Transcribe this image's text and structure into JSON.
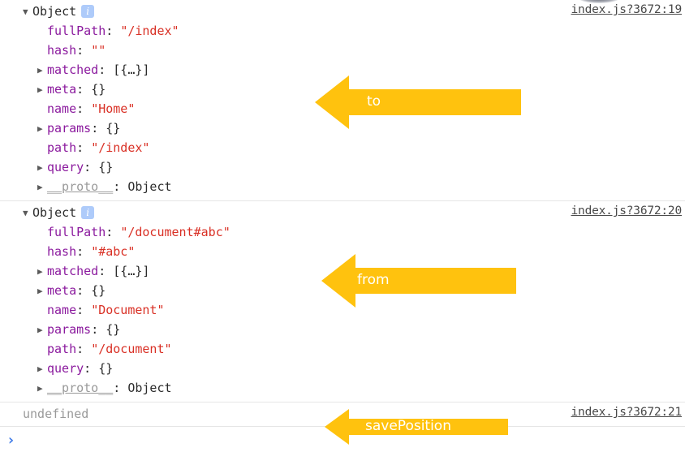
{
  "console": {
    "entries": [
      {
        "id": "entry-to",
        "source_link": "index.js?3672:19",
        "header": "Object",
        "info_icon": "i",
        "properties": [
          {
            "expandable": false,
            "key": "fullPath",
            "value": "\"/index\"",
            "value_type": "string"
          },
          {
            "expandable": false,
            "key": "hash",
            "value": "\"\"",
            "value_type": "string"
          },
          {
            "expandable": true,
            "key": "matched",
            "value": "[{…}]",
            "value_type": "object"
          },
          {
            "expandable": true,
            "key": "meta",
            "value": "{}",
            "value_type": "object"
          },
          {
            "expandable": false,
            "key": "name",
            "value": "\"Home\"",
            "value_type": "string"
          },
          {
            "expandable": true,
            "key": "params",
            "value": "{}",
            "value_type": "object"
          },
          {
            "expandable": false,
            "key": "path",
            "value": "\"/index\"",
            "value_type": "string"
          },
          {
            "expandable": true,
            "key": "query",
            "value": "{}",
            "value_type": "object"
          },
          {
            "expandable": true,
            "key": "__proto__",
            "value": "Object",
            "value_type": "proto"
          }
        ]
      },
      {
        "id": "entry-from",
        "source_link": "index.js?3672:20",
        "header": "Object",
        "info_icon": "i",
        "properties": [
          {
            "expandable": false,
            "key": "fullPath",
            "value": "\"/document#abc\"",
            "value_type": "string"
          },
          {
            "expandable": false,
            "key": "hash",
            "value": "\"#abc\"",
            "value_type": "string"
          },
          {
            "expandable": true,
            "key": "matched",
            "value": "[{…}]",
            "value_type": "object"
          },
          {
            "expandable": true,
            "key": "meta",
            "value": "{}",
            "value_type": "object"
          },
          {
            "expandable": false,
            "key": "name",
            "value": "\"Document\"",
            "value_type": "string"
          },
          {
            "expandable": true,
            "key": "params",
            "value": "{}",
            "value_type": "object"
          },
          {
            "expandable": false,
            "key": "path",
            "value": "\"/document\"",
            "value_type": "string"
          },
          {
            "expandable": true,
            "key": "query",
            "value": "{}",
            "value_type": "object"
          },
          {
            "expandable": true,
            "key": "__proto__",
            "value": "Object",
            "value_type": "proto"
          }
        ]
      },
      {
        "id": "entry-savePosition",
        "source_link": "index.js?3672:21",
        "value": "undefined"
      }
    ],
    "prompt_symbol": "›"
  },
  "annotations": [
    {
      "id": "annotation-to",
      "label": "to"
    },
    {
      "id": "annotation-from",
      "label": "from"
    },
    {
      "id": "annotation-savePosition",
      "label": "savePosition"
    }
  ],
  "colors": {
    "arrow_fill": "#FFC20E",
    "key_text": "#8b1a9e",
    "string_value": "#d93025",
    "info_badge_bg": "#aecbfa",
    "prompt_chevron": "#3b78e7",
    "undefined_text": "#9a9a9a",
    "divider": "#e6e6e6"
  }
}
